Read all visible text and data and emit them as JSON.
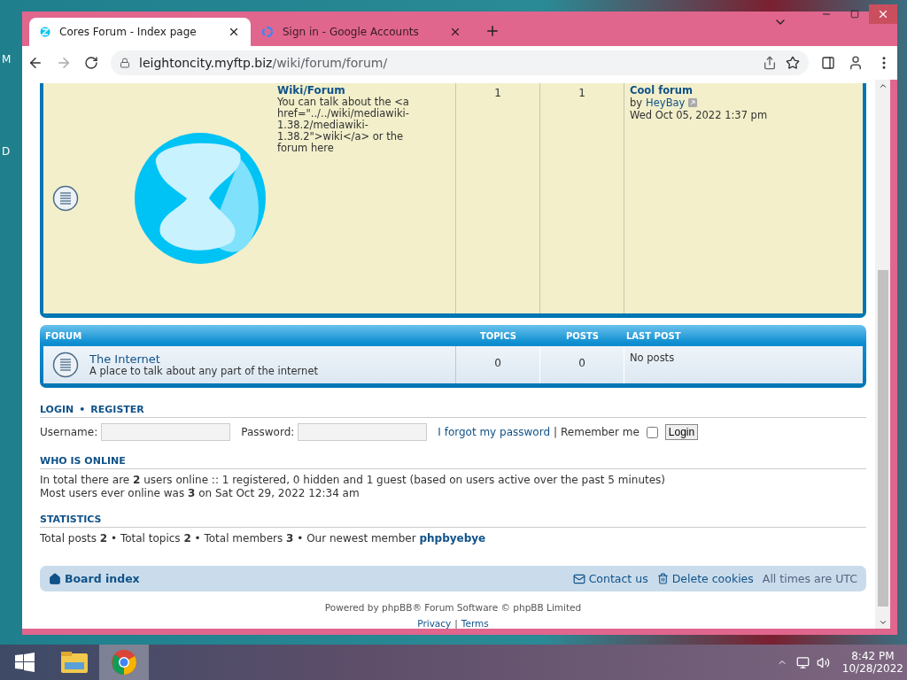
{
  "desktop": {
    "labels": [
      "M",
      "D"
    ]
  },
  "browser": {
    "tabs": [
      {
        "title": "Cores Forum - Index page",
        "selected": true
      },
      {
        "title": "Sign in - Google Accounts",
        "selected": false
      }
    ],
    "url_host": "leightoncity.myftp.biz",
    "url_path": "/wiki/forum/forum/"
  },
  "forums": [
    {
      "kind": "image",
      "rows": [
        {
          "title": "Wiki/Forum",
          "description": "You can talk about the <a href=\"../../wiki/mediawiki-1.38.2/mediawiki-1.38.2\">wiki</a> or the forum here",
          "topics": "1",
          "posts": "1",
          "last_post": {
            "title": "Cool forum",
            "by": "by",
            "author": "HeyBay",
            "date": "Wed Oct 05, 2022 1:37 pm"
          }
        }
      ]
    },
    {
      "kind": "plain",
      "header": {
        "forum": "FORUM",
        "topics": "TOPICS",
        "posts": "POSTS",
        "last_post": "LAST POST"
      },
      "rows": [
        {
          "title": "The Internet",
          "description": "A place to talk about any part of the internet",
          "topics": "0",
          "posts": "0",
          "last_post": {
            "text": "No posts"
          }
        }
      ]
    }
  ],
  "login": {
    "login": "LOGIN",
    "separator": "•",
    "register": "REGISTER",
    "username_label": "Username:",
    "password_label": "Password:",
    "forgot": "I forgot my password",
    "divider": "|",
    "remember": "Remember me",
    "remember_checked": false,
    "button": "Login"
  },
  "who_is_online": {
    "heading": "WHO IS ONLINE",
    "lines": [
      "In total there are **2** users online :: 1 registered, 0 hidden and 1 guest (based on users active over the past 5 minutes)",
      "Most users ever online was **3** on Sat Oct 29, 2022 12:34 am"
    ]
  },
  "statistics": {
    "heading": "STATISTICS",
    "text": "Total posts **2** • Total topics **2** • Total members **3** • Our newest member",
    "newest_member": "phpbyebye"
  },
  "navbar": {
    "board_index": "Board index",
    "contact": "Contact us",
    "delete_cookies": "Delete cookies",
    "timezone": "All times are UTC"
  },
  "footer": {
    "powered": "Powered by phpBB® Forum Software © phpBB Limited",
    "privacy": "Privacy",
    "divider": "|",
    "terms": "Terms"
  },
  "taskbar": {
    "time": "8:42 PM",
    "date": "10/28/2022"
  }
}
